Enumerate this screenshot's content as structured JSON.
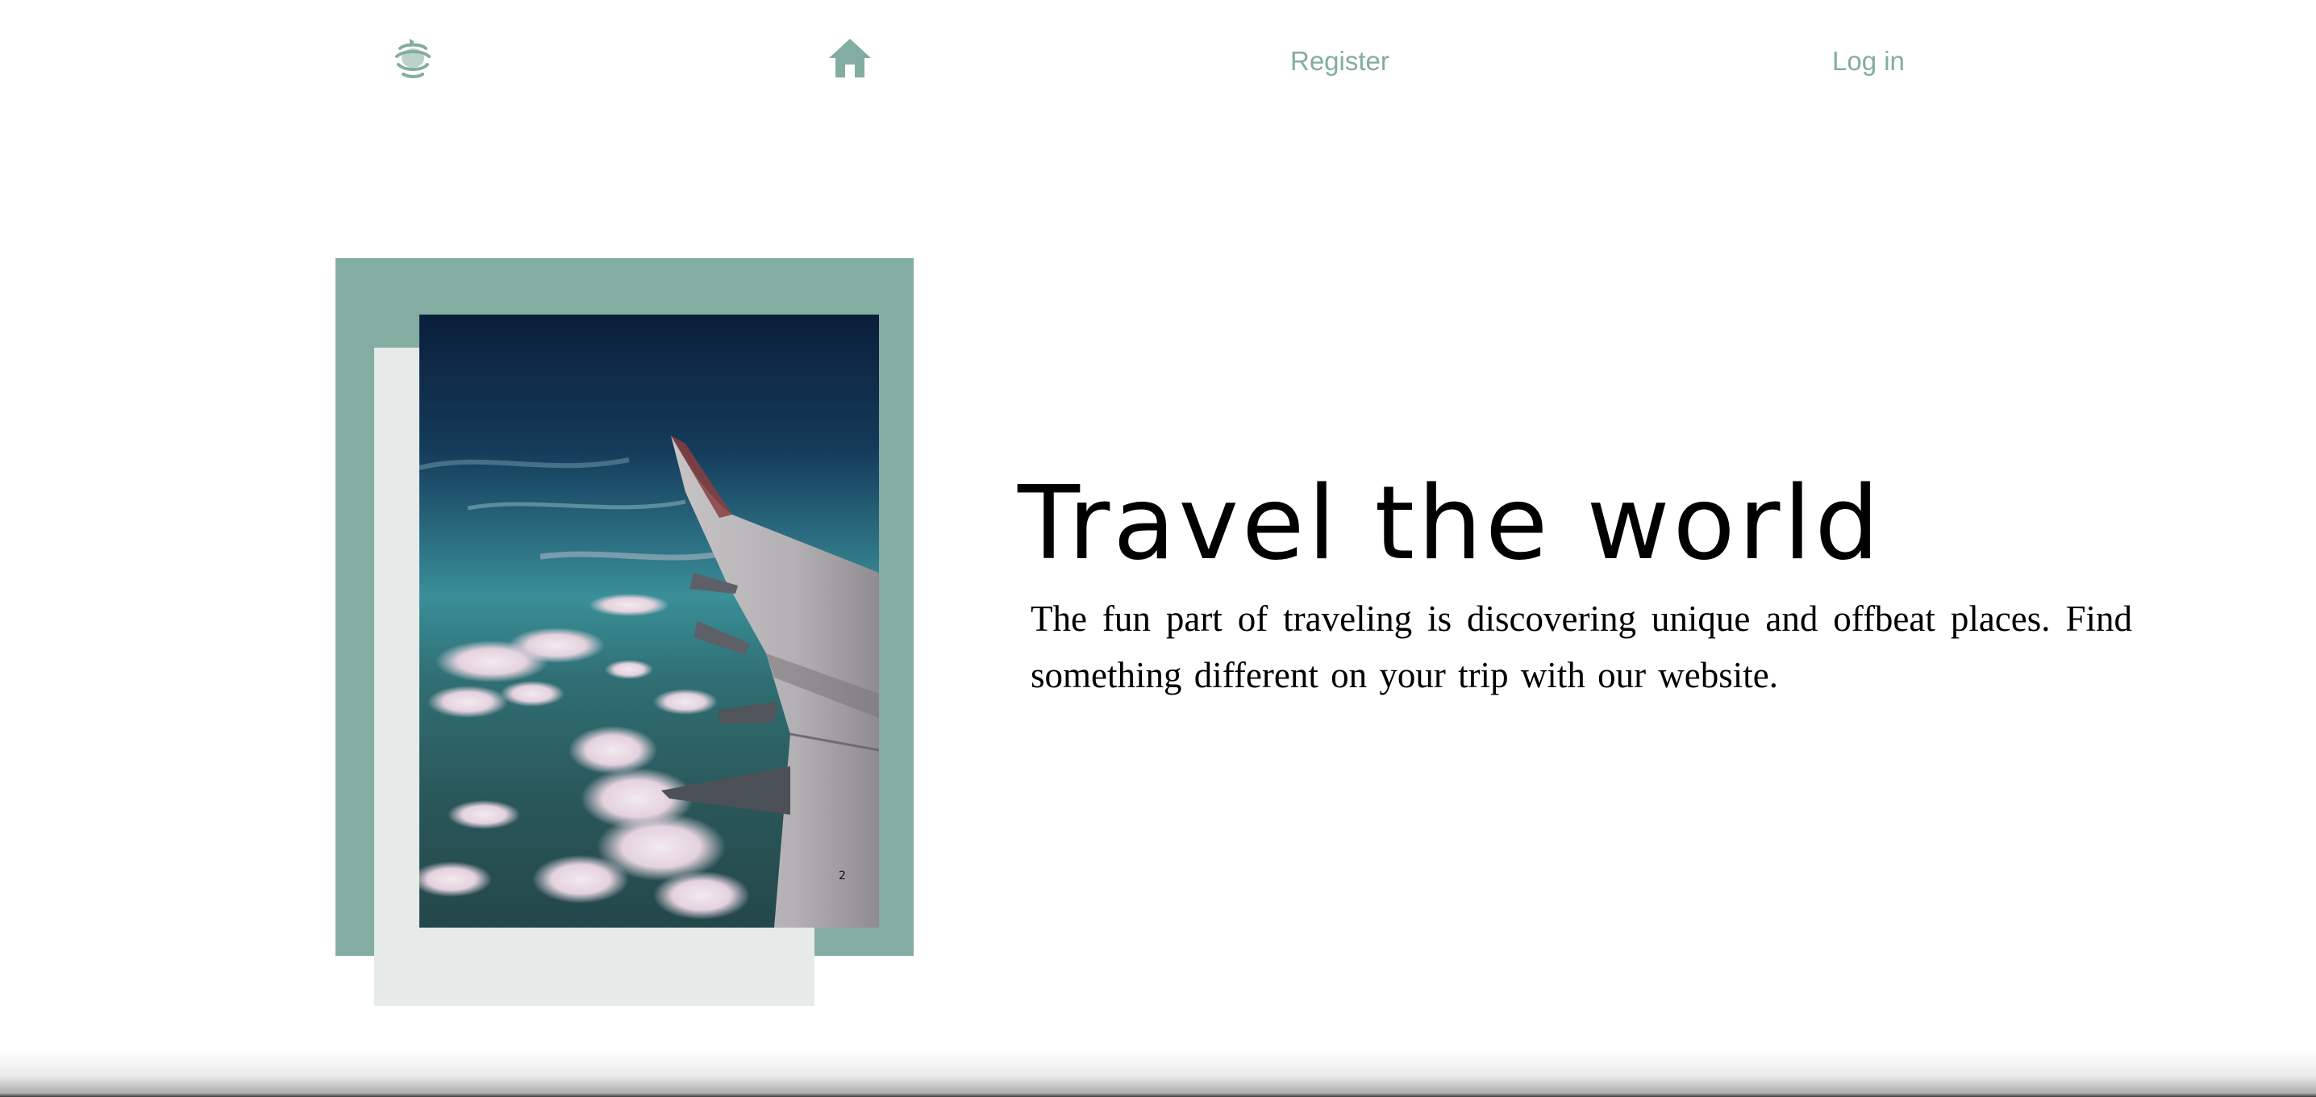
{
  "nav": {
    "logo_icon": "globe-stack-logo-icon",
    "home_icon": "home-icon",
    "register_label": "Register",
    "login_label": "Log in",
    "accent_color": "#83ada1"
  },
  "hero": {
    "title": "Travel the world",
    "description": "The fun part of traveling is discovering unique and offbeat places. Find something different on your trip with our website.",
    "image_icon": "airplane-wing-photo",
    "frame_color": "#84ada1",
    "frame_secondary_color": "#e6eae9"
  }
}
